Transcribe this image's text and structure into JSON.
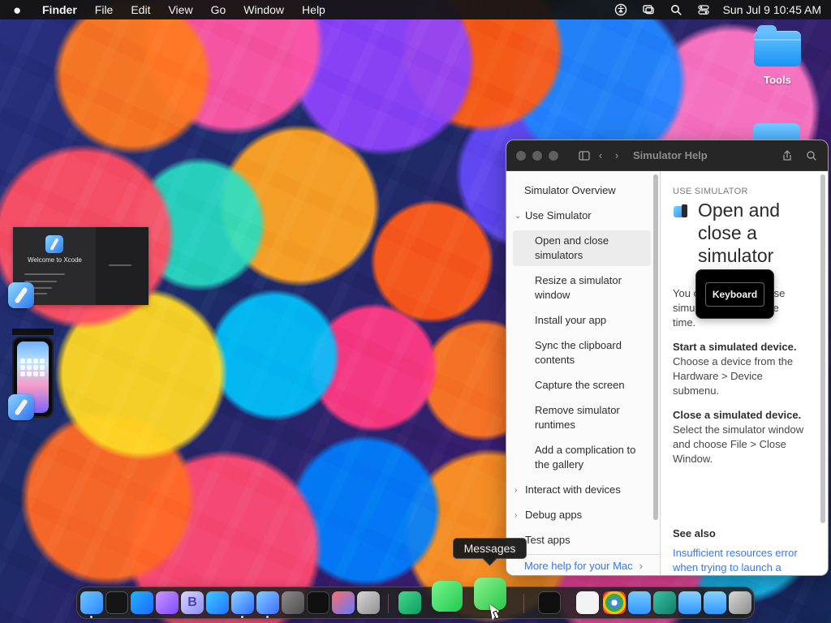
{
  "menubar": {
    "apple_icon": "apple-icon",
    "app_name": "Finder",
    "menus": [
      "File",
      "Edit",
      "View",
      "Go",
      "Window",
      "Help"
    ],
    "status_icons": [
      "accessibility-icon",
      "screen-mirroring-icon",
      "search-icon",
      "control-center-icon"
    ],
    "clock": "Sun Jul 9  10:45 AM"
  },
  "desktop": {
    "folder_label": "Tools",
    "xcode_preview_text": "Welcome to Xcode"
  },
  "help": {
    "toolbar_title": "Simulator Help",
    "sidebar": {
      "items": [
        {
          "label": "Simulator Overview",
          "kind": "top"
        },
        {
          "label": "Use Simulator",
          "kind": "parent-open"
        },
        {
          "label": "Open and close simulators",
          "kind": "child-selected"
        },
        {
          "label": "Resize a simulator window",
          "kind": "child"
        },
        {
          "label": "Install your app",
          "kind": "child"
        },
        {
          "label": "Sync the clipboard contents",
          "kind": "child"
        },
        {
          "label": "Capture the screen",
          "kind": "child"
        },
        {
          "label": "Remove simulator runtimes",
          "kind": "child"
        },
        {
          "label": "Add a complication to the gallery",
          "kind": "child"
        },
        {
          "label": "Interact with devices",
          "kind": "parent-closed"
        },
        {
          "label": "Debug apps",
          "kind": "parent-closed"
        },
        {
          "label": "Test apps",
          "kind": "parent-closed"
        }
      ],
      "footer": "More help for your Mac"
    },
    "content": {
      "section_label": "USE SIMULATOR",
      "title": "Open and close a simulator",
      "intro": "You can open and close simulators at the same time.",
      "paragraphs": [
        {
          "lead": "Start a simulated device.",
          "body": "Choose a device from the Hardware > Device submenu."
        },
        {
          "lead": "Close a simulated device.",
          "body": "Select the simulator window and choose File > Close Window."
        }
      ],
      "see_also_title": "See also",
      "see_also_link": "Insufficient resources error when trying to launch a simulator"
    },
    "tooltip": "Keyboard"
  },
  "dock": {
    "tooltip": "Messages",
    "items": [
      {
        "name": "finder-icon",
        "label": "",
        "active": true
      },
      {
        "name": "terminal-icon",
        "label": "",
        "active": false
      },
      {
        "name": "vscode-icon",
        "label": "",
        "active": false
      },
      {
        "name": "visual-studio-icon",
        "label": "",
        "active": false
      },
      {
        "name": "bbedit-icon",
        "label": "B",
        "active": false
      },
      {
        "name": "app-store-icon",
        "label": "",
        "active": false
      },
      {
        "name": "xcode-icon",
        "label": "",
        "active": true
      },
      {
        "name": "simulator-icon",
        "label": "",
        "active": true
      },
      {
        "name": "system-settings-icon",
        "label": "",
        "active": false
      },
      {
        "name": "activity-monitor-icon",
        "label": "",
        "active": false
      },
      {
        "name": "shortcuts-icon",
        "label": "",
        "active": false
      },
      {
        "name": "launchpad-icon",
        "label": "",
        "active": false
      },
      {
        "name": "tasks-icon",
        "label": "",
        "active": false
      },
      {
        "name": "facetime-icon",
        "label": "",
        "active": false
      },
      {
        "name": "messages-icon",
        "label": "",
        "active": false
      },
      {
        "name": "console-icon",
        "label": "",
        "active": false
      },
      {
        "name": "document-icon",
        "label": "",
        "active": false
      },
      {
        "name": "chrome-icon",
        "label": "",
        "active": false
      },
      {
        "name": "folder-icon",
        "label": "",
        "active": false
      },
      {
        "name": "app-grid-icon",
        "label": "",
        "active": false
      },
      {
        "name": "folder-icon",
        "label": "",
        "active": false
      },
      {
        "name": "folder-icon",
        "label": "",
        "active": false
      },
      {
        "name": "trash-icon",
        "label": "",
        "active": false
      }
    ]
  }
}
